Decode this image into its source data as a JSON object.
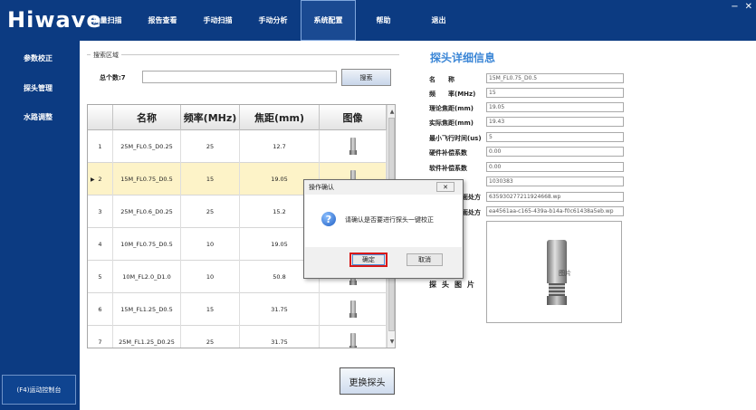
{
  "app": {
    "logo": "Hiwave",
    "minimize": "−",
    "close": "✕"
  },
  "nav": {
    "items": [
      "批量扫描",
      "报告查看",
      "手动扫描",
      "手动分析",
      "系统配置",
      "帮助",
      "退出"
    ],
    "active": "系统配置"
  },
  "sidebar": {
    "items": [
      "参数校正",
      "探头管理",
      "水路调整"
    ],
    "bottom": "(F4)运动控制台"
  },
  "search": {
    "legend": "搜索区域",
    "total_label": "总个数:7",
    "input_value": "",
    "button": "搜索"
  },
  "table": {
    "headers": [
      "",
      "名称",
      "频率(MHz)",
      "焦距(mm)",
      "图像"
    ],
    "rows": [
      {
        "index": "1",
        "name": "25M_FL0.5_D0.25",
        "freq": "25",
        "focus": "12.7",
        "selected": false
      },
      {
        "index": "2",
        "name": "15M_FL0.75_D0.5",
        "freq": "15",
        "focus": "19.05",
        "selected": true
      },
      {
        "index": "3",
        "name": "25M_FL0.6_D0.25",
        "freq": "25",
        "focus": "15.2",
        "selected": false
      },
      {
        "index": "4",
        "name": "10M_FL0.75_D0.5",
        "freq": "10",
        "focus": "19.05",
        "selected": false
      },
      {
        "index": "5",
        "name": "10M_FL2.0_D1.0",
        "freq": "10",
        "focus": "50.8",
        "selected": false
      },
      {
        "index": "6",
        "name": "15M_FL1.25_D0.5",
        "freq": "15",
        "focus": "31.75",
        "selected": false
      },
      {
        "index": "7",
        "name": "25M_FL1.25_D0.25",
        "freq": "25",
        "focus": "31.75",
        "selected": false
      }
    ],
    "selected_marker": "▶",
    "scroll_up": "▲",
    "scroll_down": "▼"
  },
  "replace_button": "更换探头",
  "detail": {
    "title": "探头详细信息",
    "fields": [
      {
        "label": "名　　称",
        "value": "15M_FL0.75_D0.5"
      },
      {
        "label": "频　　率(MHz)",
        "value": "15"
      },
      {
        "label": "理论焦距(mm)",
        "value": "19.05"
      },
      {
        "label": "实际焦距(mm)",
        "value": "19.43"
      },
      {
        "label": "最小飞行时间(us)",
        "value": "5"
      },
      {
        "label": "硬件补偿系数",
        "value": "0.00"
      },
      {
        "label": "软件补偿系数",
        "value": "0.00"
      },
      {
        "label": "",
        "value": "1030383"
      },
      {
        "label": "面处方",
        "value": "635930277211924668.wp"
      },
      {
        "label": "面处方",
        "value": "ea4561aa-c165-439a-b14a-f0c61438a5eb.wp"
      }
    ],
    "photo_caption": "图片",
    "photo_label": "探头图片"
  },
  "dialog": {
    "title": "操作确认",
    "close": "✕",
    "icon": "?",
    "message": "请确认是否要进行探头一键校正",
    "ok": "确定",
    "cancel": "取消"
  }
}
